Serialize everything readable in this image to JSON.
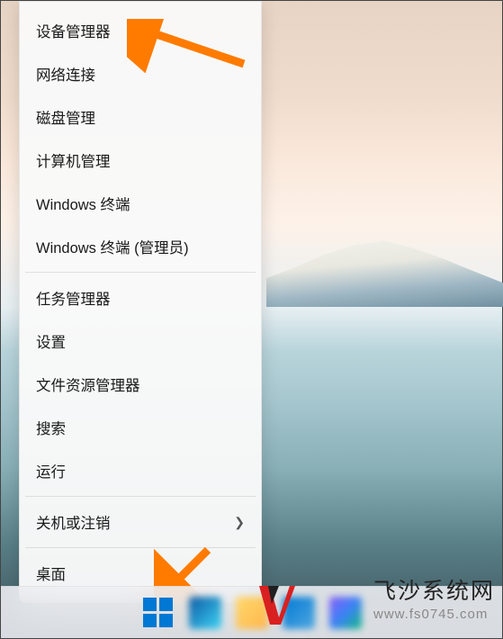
{
  "menu": {
    "group1": [
      {
        "label": "设备管理器"
      },
      {
        "label": "网络连接"
      },
      {
        "label": "磁盘管理"
      },
      {
        "label": "计算机管理"
      },
      {
        "label": "Windows 终端"
      },
      {
        "label": "Windows 终端 (管理员)"
      }
    ],
    "group2": [
      {
        "label": "任务管理器"
      },
      {
        "label": "设置"
      },
      {
        "label": "文件资源管理器"
      },
      {
        "label": "搜索"
      },
      {
        "label": "运行"
      }
    ],
    "group3": [
      {
        "label": "关机或注销",
        "hasSubmenu": true
      }
    ],
    "group4": [
      {
        "label": "桌面"
      }
    ]
  },
  "watermark": {
    "title": "飞沙系统网",
    "url": "www.fs0745.com"
  },
  "annotations": {
    "arrow_target_1": "设备管理器",
    "arrow_target_2": "start-button"
  }
}
